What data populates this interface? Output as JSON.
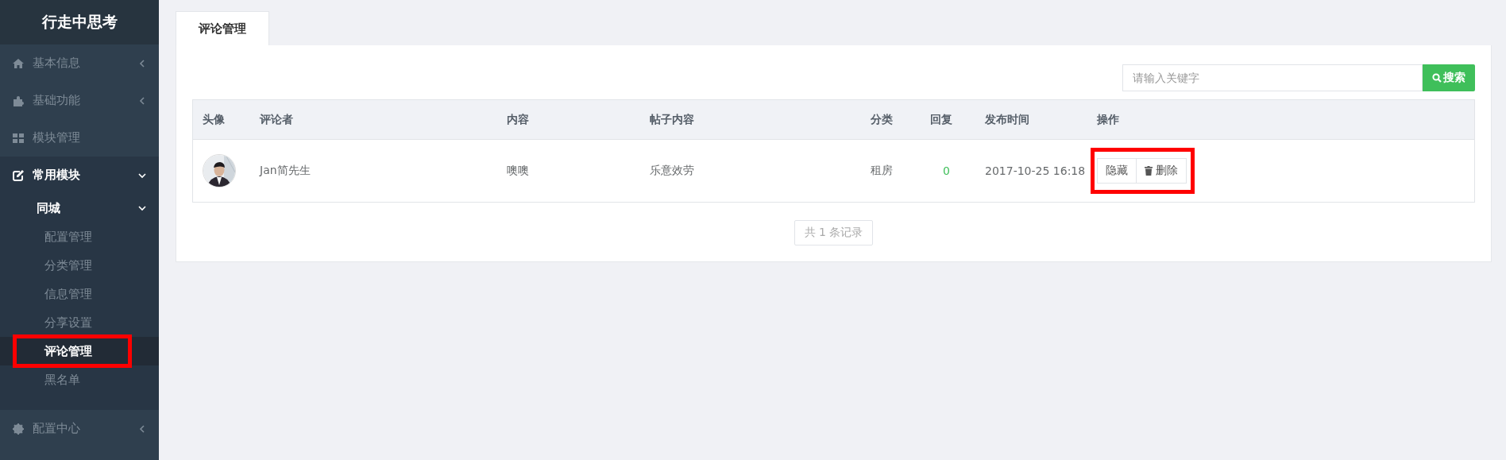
{
  "sidebar": {
    "title": "行走中思考",
    "items": [
      {
        "label": "基本信息",
        "expanded": false
      },
      {
        "label": "基础功能",
        "expanded": false
      },
      {
        "label": "模块管理"
      },
      {
        "label": "常用模块",
        "expanded": true,
        "children": [
          {
            "label": "同城",
            "expanded": true,
            "children": [
              {
                "label": "配置管理",
                "selected": false
              },
              {
                "label": "分类管理",
                "selected": false
              },
              {
                "label": "信息管理",
                "selected": false
              },
              {
                "label": "分享设置",
                "selected": false
              },
              {
                "label": "评论管理",
                "selected": true
              },
              {
                "label": "黑名单",
                "selected": false
              }
            ]
          }
        ]
      },
      {
        "label": "配置中心",
        "expanded": false
      }
    ]
  },
  "tabs": [
    {
      "label": "评论管理",
      "selected": true
    }
  ],
  "search": {
    "placeholder": "请输入关键字",
    "button": "搜索"
  },
  "table": {
    "columns": [
      "头像",
      "评论者",
      "内容",
      "帖子内容",
      "分类",
      "回复",
      "发布时间",
      "操作"
    ],
    "rows": [
      {
        "commenter": "Jan简先生",
        "content": "噢噢",
        "post": "乐意效劳",
        "category": "租房",
        "replies": "0",
        "time": "2017-10-25 16:18",
        "actions": [
          "隐藏",
          "删除"
        ]
      }
    ]
  },
  "pagination": "共 1 条记录"
}
